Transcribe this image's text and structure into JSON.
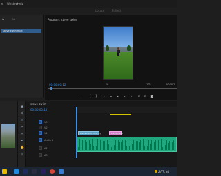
{
  "menu": {
    "items": [
      "e",
      "Window",
      "Help"
    ]
  },
  "title_bar": {
    "left": "Locate",
    "right": "Edited"
  },
  "project_panel": {
    "tabs": [
      "ts",
      "Ed"
    ],
    "item_label": "steve swim.mp4"
  },
  "program_monitor": {
    "title": "Program: steve swim",
    "timecode": "00:00:00:12",
    "fit": "Fit",
    "fraction": "1/2",
    "end_timecode": "00:00:2"
  },
  "transport": {
    "buttons": [
      "marker-icon",
      "in-point-icon",
      "out-point-icon",
      "go-to-in-icon",
      "step-back-icon",
      "play-icon",
      "step-forward-icon",
      "go-to-out-icon",
      "insert-icon",
      "overwrite-icon",
      "camera-icon"
    ]
  },
  "timeline": {
    "tab_label": "steve swim",
    "timecode": "00:00:00:12",
    "tracks": [
      {
        "id": "V3",
        "label": "V3"
      },
      {
        "id": "V2",
        "label": "V2"
      },
      {
        "id": "V1",
        "label": "V1"
      },
      {
        "id": "A1",
        "label": "Audio 1"
      },
      {
        "id": "A2",
        "label": "A2"
      },
      {
        "id": "A3",
        "label": "A3"
      }
    ],
    "clips": {
      "v1_clip_1": "steve swim.mp4 [V]",
      "v1_clip_2": "steve swim"
    }
  },
  "tools": [
    "selection-tool-icon",
    "track-select-icon",
    "ripple-edit-icon",
    "razor-icon",
    "slip-icon",
    "pen-icon",
    "hand-icon",
    "type-icon"
  ],
  "taskbar": {
    "weather": "27°C Su",
    "apps": [
      "file-explorer-icon",
      "edge-icon",
      "after-effects-icon",
      "app-icon",
      "premiere-icon",
      "chrome-icon",
      "photos-icon"
    ]
  },
  "colors": {
    "accent_blue": "#3b8fe8",
    "clip_video": "#5aa0c6",
    "clip_pink": "#d47bc8",
    "clip_audio": "#21a77d",
    "selection": "#2e5d8d"
  }
}
